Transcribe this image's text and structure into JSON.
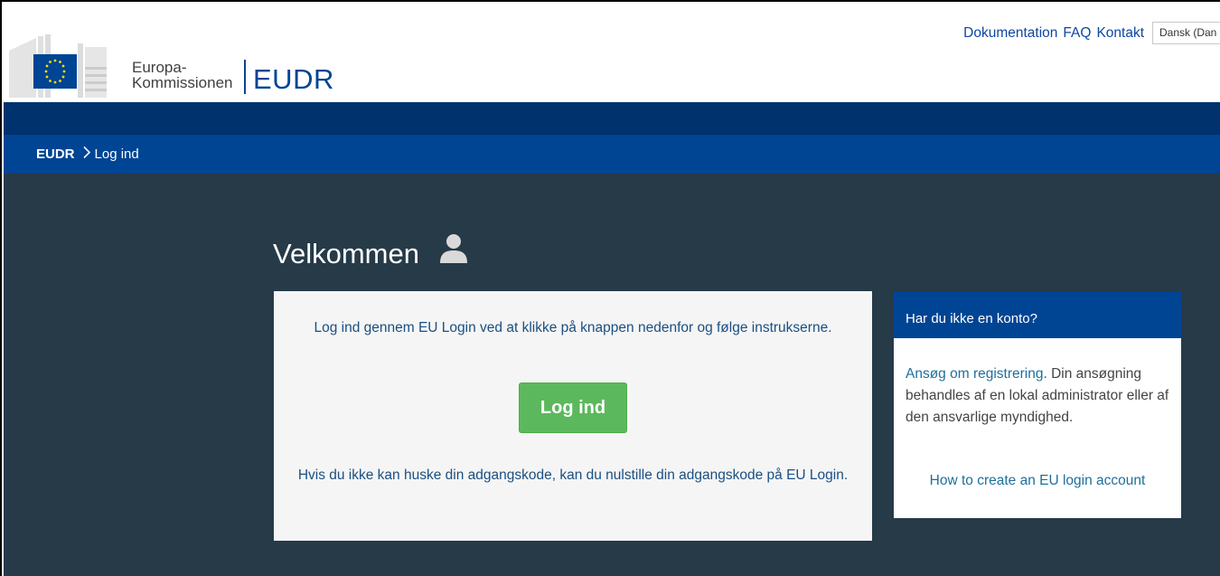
{
  "header": {
    "logo_alt": "European Commission logo",
    "org_name_line1": "Europa-",
    "org_name_line2": "Kommissionen",
    "app_name": "EUDR",
    "links": {
      "documentation": "Dokumentation",
      "faq": "FAQ",
      "contact": "Kontakt"
    },
    "language_value": "Dansk (Dan"
  },
  "breadcrumb": {
    "root": "EUDR",
    "current": "Log ind",
    "separator_icon": "chevron-right-icon"
  },
  "main": {
    "title": "Velkommen",
    "title_icon": "user-icon",
    "login_card": {
      "text_before_link": "Log ind gennem ",
      "link_text": "EU Login",
      "text_after_link": " ved at klikke på knappen nedenfor og følge instrukserne.",
      "button_label": "Log ind",
      "reset_text": "Hvis du ikke kan huske din adgangskode, kan du nulstille din adgangskode på EU Login."
    },
    "side_card": {
      "heading": "Har du ikke en konto?",
      "register_link": "Ansøg om registrering",
      "register_text": ". Din ansøgning behandles af en lokal administrator eller af den ansvarlige myndighed.",
      "help_link": "How to create an EU login account"
    }
  },
  "colors": {
    "brand_blue": "#004494",
    "dark_band": "#00326e",
    "background": "#263a48",
    "button_green": "#5cb85c",
    "eu_star_yellow": "#ffdd00"
  }
}
